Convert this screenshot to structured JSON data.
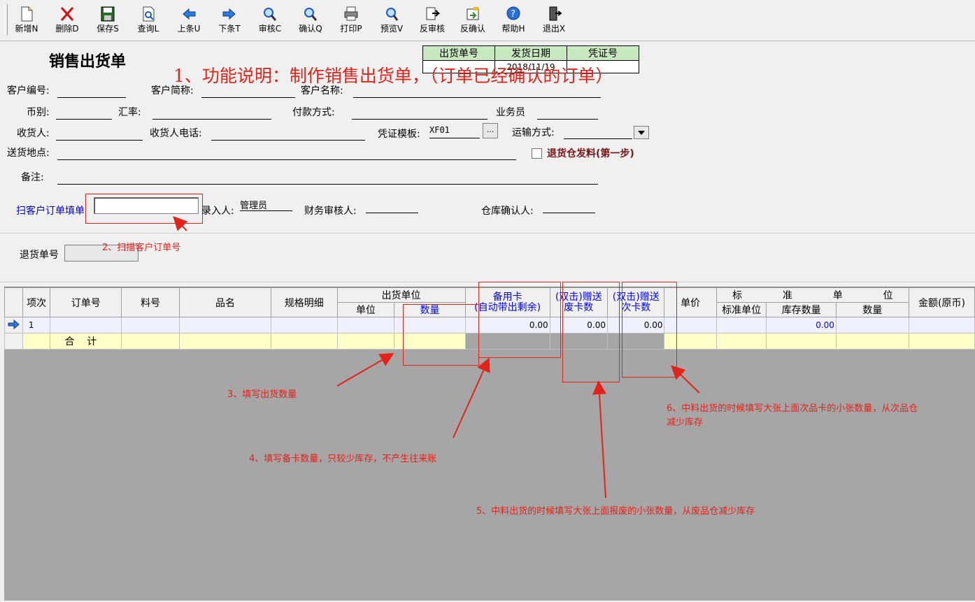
{
  "toolbar": {
    "buttons": [
      {
        "label": "新增N",
        "icon": "new-document-icon"
      },
      {
        "label": "删除D",
        "icon": "delete-x-icon"
      },
      {
        "label": "保存S",
        "icon": "save-disk-icon"
      },
      {
        "label": "查询L",
        "icon": "query-document-icon"
      },
      {
        "label": "上条U",
        "icon": "arrow-left-icon"
      },
      {
        "label": "下条T",
        "icon": "arrow-right-icon"
      },
      {
        "label": "审核C",
        "icon": "magnifier-icon"
      },
      {
        "label": "确认Q",
        "icon": "magnifier-icon"
      },
      {
        "label": "打印P",
        "icon": "printer-icon"
      },
      {
        "label": "预览V",
        "icon": "preview-magnifier-icon"
      },
      {
        "label": "反审核",
        "icon": "unaudit-icon"
      },
      {
        "label": "反确认",
        "icon": "unconfirm-icon"
      },
      {
        "label": "帮助H",
        "icon": "help-icon"
      },
      {
        "label": "退出X",
        "icon": "exit-door-icon"
      }
    ]
  },
  "form": {
    "title": "销售出货单",
    "header_table": {
      "col1": "出货单号",
      "col2": "发货日期",
      "col3": "凭证号",
      "val1": "",
      "val2": "2018/11/19",
      "val3": ""
    },
    "labels": {
      "customer_no": "客户编号:",
      "customer_short": "客户简称:",
      "customer_name": "客户名称:",
      "currency": "币别:",
      "rate": "汇率:",
      "payment": "付款方式:",
      "salesman": "业务员",
      "receiver": "收货人:",
      "receiver_phone": "收货人电话:",
      "voucher_template": "凭证模板:",
      "transport": "运输方式:",
      "address": "送货地点:",
      "return_checkbox": "退货仓发料(第一步)",
      "remark": "备注:",
      "scan_order": "扫客户订单填单",
      "entry_person": "录入人:",
      "finance_auditor": "财务审核人:",
      "warehouse_confirmer": "仓库确认人:",
      "return_no": "退货单号"
    },
    "values": {
      "voucher_template": "XF01",
      "entry_person": "管理员",
      "ellipsis": "..."
    }
  },
  "grid": {
    "headers": {
      "item": "项次",
      "order_no": "订单号",
      "part_no": "料号",
      "name": "品名",
      "spec": "规格明细",
      "ship_unit": "出货单位",
      "unit": "单位",
      "qty": "数量",
      "spare_card_1": "备用卡",
      "spare_card_2": "(自动带出剩余)",
      "waste_1": "(双击)赠送",
      "waste_2": "废卡数",
      "defect_1": "(双击)赠送",
      "defect_2": "次卡数",
      "price": "单价",
      "std_1": "标",
      "std_2": "准",
      "std_3": "单",
      "std_4": "位",
      "std_unit": "标准单位",
      "stock_qty": "库存数量",
      "std_qty": "数量",
      "amount": "金额(原币)"
    },
    "row1": {
      "item": "1",
      "spare": "0.00",
      "waste": "0.00",
      "defect": "0.00",
      "stock": "0.00"
    },
    "total_label_1": "合",
    "total_label_2": "计"
  },
  "annotations": {
    "a1": "1、功能说明：制作销售出货单，（订单已经确认的订单）",
    "a2": "2、扫描客户订单号",
    "a3": "3、填写出货数量",
    "a4": "4、填写备卡数量，只较少库存，不产生往来账",
    "a5": "5、中料出货的时候填写大张上面报废的小张数量，从废品仓减少库存",
    "a6_1": "6、中料出货的时候填写大张上面次品卡的小张数量，从次品仓",
    "a6_2": "减少库存"
  },
  "colors": {
    "annotation": "#e2231a",
    "link_blue": "#0000ff",
    "header_green": "#c8e8c0",
    "grid_bg": "#a6a6a6"
  }
}
